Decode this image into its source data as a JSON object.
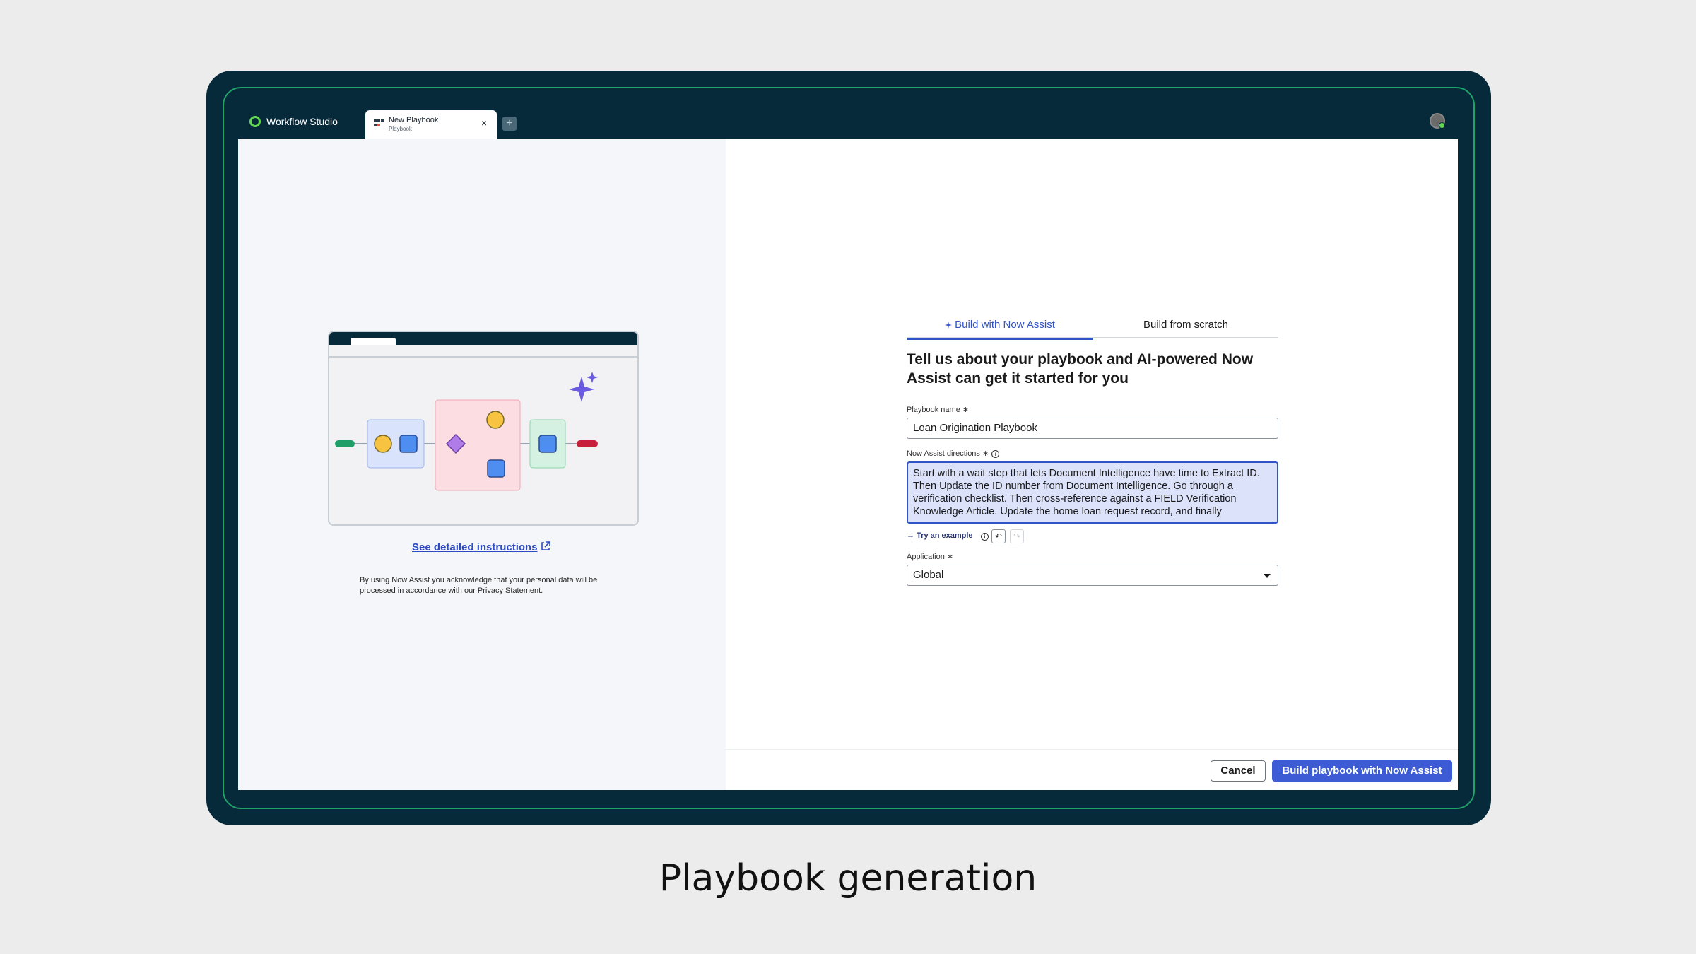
{
  "app": {
    "name": "Workflow Studio"
  },
  "tab": {
    "title": "New Playbook",
    "subtitle": "Playbook",
    "close_glyph": "×",
    "add_glyph": "+"
  },
  "left_pane": {
    "instructions_link": "See detailed instructions",
    "privacy_text": "By using Now Assist you acknowledge that your personal data will be processed in accordance with our Privacy Statement."
  },
  "form": {
    "tabs": [
      {
        "label": "Build with Now Assist",
        "active": true
      },
      {
        "label": "Build from scratch",
        "active": false
      }
    ],
    "title": "Tell us about your playbook and AI-powered Now Assist can get it started for you",
    "playbook_name": {
      "label": "Playbook name",
      "required_mark": "∗",
      "value": "Loan Origination Playbook"
    },
    "directions": {
      "label": "Now Assist directions",
      "required_mark": "∗",
      "value": "Start with a wait step that lets Document Intelligence have time to Extract ID. Then Update the ID number from Document Intelligence. Go through a verification checklist. Then cross-reference against a FIELD Verification Knowledge Article. Update the home loan request record, and finally"
    },
    "try_example": "→ Try an example",
    "undo_glyph": "↶",
    "redo_glyph": "↷",
    "application": {
      "label": "Application",
      "required_mark": "∗",
      "value": "Global"
    }
  },
  "footer": {
    "cancel_label": "Cancel",
    "build_label": "Build playbook with Now Assist"
  },
  "caption": "Playbook generation",
  "icons": [
    "now-logo-icon",
    "playbook-icon",
    "close-icon",
    "plus-icon",
    "avatar",
    "sparkle-icon",
    "external-link-icon",
    "info-icon",
    "undo-icon",
    "redo-icon",
    "chevron-down-icon"
  ],
  "colors": {
    "frame": "#062a3a",
    "accent": "#3e5bd6",
    "brand_green": "#62d84e",
    "textarea_bg": "#dbe2fa"
  }
}
